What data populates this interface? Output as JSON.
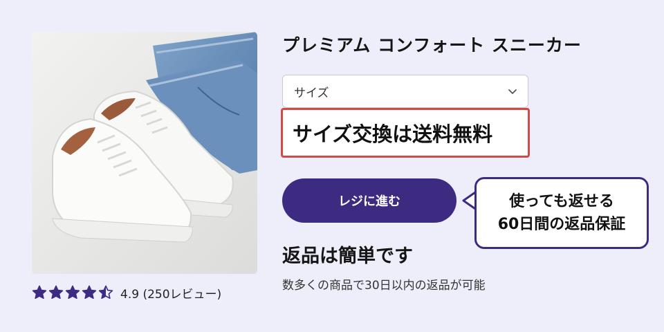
{
  "product": {
    "title": "プレミアム コンフォート スニーカー",
    "image_icon": "white-sneakers-photo"
  },
  "rating": {
    "value": 4.5,
    "max": 5,
    "text": "4.9 (250レビュー)",
    "star_color": "#3d2b82"
  },
  "size_select": {
    "selected": "サイズ",
    "icon": "chevron-down-icon"
  },
  "exchange_notice": {
    "text": "サイズ交換は送料無料",
    "border_color": "#d24a46"
  },
  "checkout": {
    "label": "レジに進む",
    "color": "#3d2b82"
  },
  "callout": {
    "line1": "使っても返せる",
    "line2": "60日間の返品保証"
  },
  "returns": {
    "heading": "返品は簡単です",
    "subtext": "数多くの商品で30日以内の返品が可能"
  }
}
